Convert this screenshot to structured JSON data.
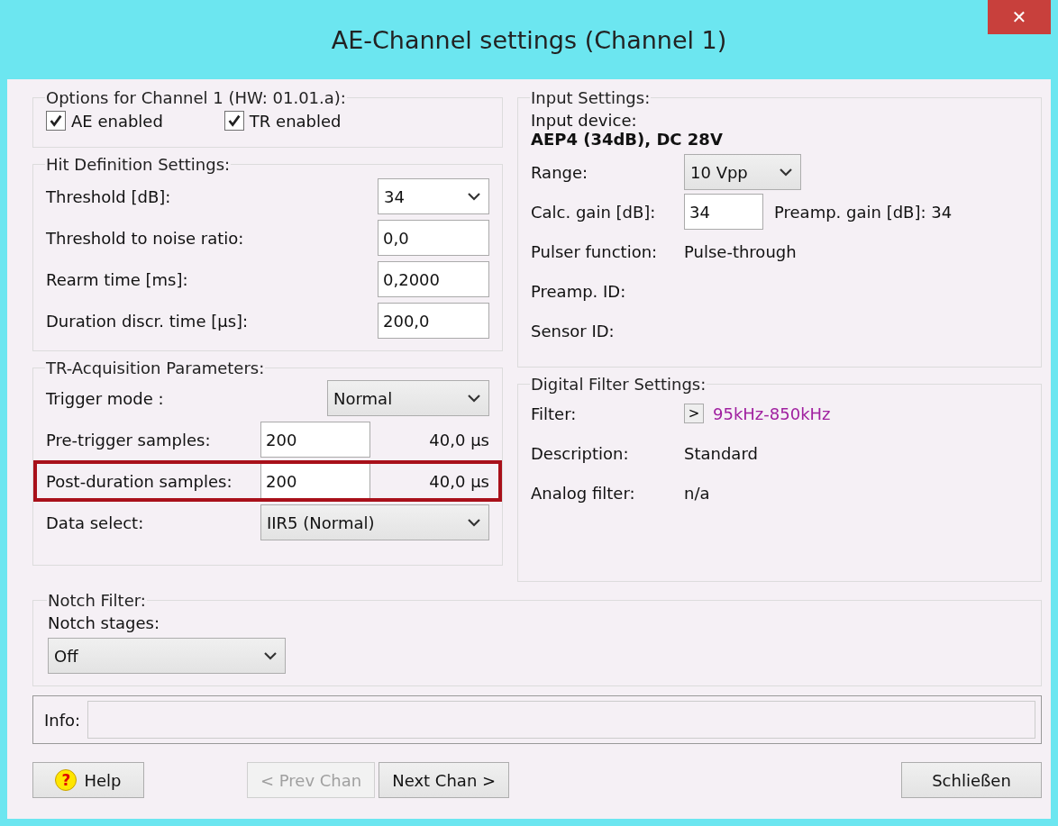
{
  "window": {
    "title": "AE-Channel settings (Channel 1)",
    "close_glyph": "✕"
  },
  "options": {
    "legend": "Options for Channel 1 (HW: 01.01.a):",
    "checkboxes": [
      {
        "label": "AE enabled",
        "checked": true
      },
      {
        "label": "TR enabled",
        "checked": true
      }
    ]
  },
  "hit_definition": {
    "legend": "Hit Definition Settings:",
    "rows": [
      {
        "label": "Threshold [dB]:",
        "kind": "dropdown",
        "value": "34"
      },
      {
        "label": "Threshold to noise ratio:",
        "kind": "field",
        "value": "0,0"
      },
      {
        "label": "Rearm time [ms]:",
        "kind": "field",
        "value": "0,2000"
      },
      {
        "label": "Duration discr. time [µs]:",
        "kind": "field",
        "value": "200,0"
      }
    ]
  },
  "input_settings": {
    "legend": "Input Settings:",
    "device_label": "Input device:",
    "device": "AEP4 (34dB), DC 28V",
    "rows": [
      {
        "label": "Range:",
        "kind": "combo",
        "value": "10 Vpp"
      },
      {
        "label": "Calc. gain [dB]:",
        "kind": "field",
        "value": "34",
        "note": "Preamp. gain [dB]: 34"
      },
      {
        "label": "Pulser function:",
        "kind": "text",
        "value": "Pulse-through"
      },
      {
        "label": "Preamp. ID:",
        "kind": "text"
      },
      {
        "label": "Sensor ID:",
        "kind": "text"
      }
    ]
  },
  "tr_acquisition": {
    "legend": "TR-Acquisition Parameters:",
    "rows": [
      {
        "label": "Trigger mode :",
        "kind": "combo",
        "value": "Normal",
        "highlighted": false
      },
      {
        "label": "Pre-trigger samples:",
        "kind": "field",
        "value": "200",
        "reading": "40,0 µs",
        "highlighted": false
      },
      {
        "label": "Post-duration samples:",
        "kind": "field",
        "value": "200",
        "reading": "40,0 µs",
        "highlighted": true
      },
      {
        "label": "Data select:",
        "kind": "combo-wide",
        "value": "IIR5 (Normal)",
        "highlighted": false
      }
    ]
  },
  "digital_filter": {
    "legend": "Digital Filter Settings:",
    "rows": [
      {
        "label": "Filter:",
        "kind": "link",
        "button": ">",
        "value": "95kHz-850kHz",
        "color": "#a020a0"
      },
      {
        "label": "Description:",
        "kind": "text",
        "value": "Standard"
      },
      {
        "label": "Analog filter:",
        "kind": "text",
        "value": "n/a"
      }
    ]
  },
  "notch_filter": {
    "legend": "Notch Filter:",
    "label": "Notch stages:",
    "value": "Off"
  },
  "info": {
    "label": "Info:"
  },
  "buttons": [
    {
      "label": "Help",
      "kind": "help",
      "icon_glyph": "?",
      "disabled": false
    },
    {
      "label": "< Prev Chan",
      "kind": "nav",
      "disabled": true
    },
    {
      "label": "Next Chan >",
      "kind": "nav",
      "disabled": false
    },
    {
      "label": "Schließen",
      "kind": "close",
      "disabled": false
    }
  ]
}
